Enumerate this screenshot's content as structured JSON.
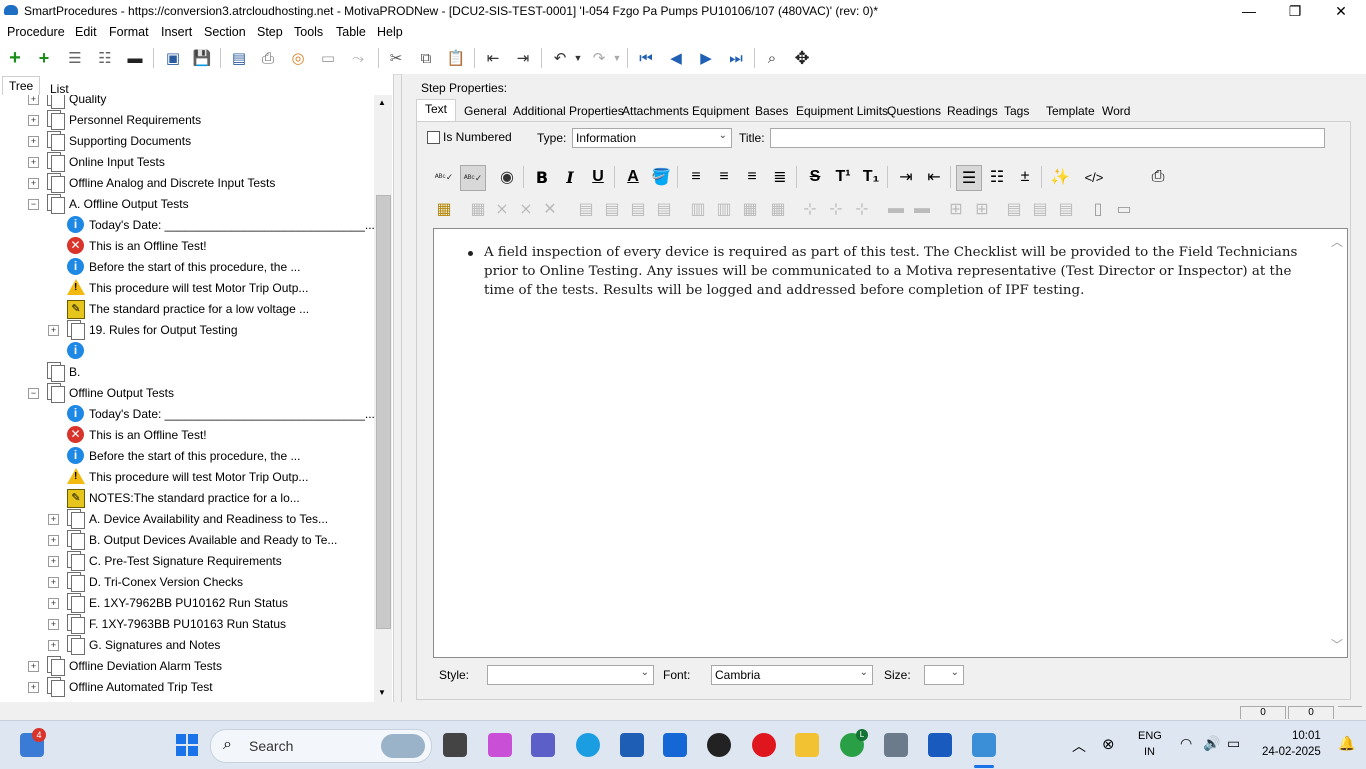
{
  "window": {
    "title": "SmartProcedures - https://conversion3.atrcloudhosting.net - MotivaPRODNew - [DCU2-SIS-TEST-0001] 'I-054 Fzgo Pa Pumps PU10106/107 (480VAC)' (rev: 0)*",
    "minimize": "—",
    "restore": "❐",
    "close": "✕"
  },
  "menu": [
    "Procedure",
    "Edit",
    "Format",
    "Insert",
    "Section",
    "Step",
    "Tools",
    "Table",
    "Help"
  ],
  "left_tabs": [
    "Tree",
    "List"
  ],
  "tree": [
    {
      "label": "Quality",
      "icon": "doc",
      "level": 0,
      "exp": "+"
    },
    {
      "label": "Personnel Requirements",
      "icon": "doc",
      "level": 0,
      "exp": "+"
    },
    {
      "label": "Supporting Documents",
      "icon": "doc",
      "level": 0,
      "exp": "+"
    },
    {
      "label": "Online Input Tests",
      "icon": "doc",
      "level": 0,
      "exp": "+"
    },
    {
      "label": "Offline Analog and Discrete Input Tests",
      "icon": "doc",
      "level": 0,
      "exp": "+"
    },
    {
      "label": "A. Offline Output Tests",
      "icon": "doc",
      "level": 0,
      "exp": "−"
    },
    {
      "label": "Today's Date: ______________________________...",
      "icon": "info",
      "level": 1,
      "exp": ""
    },
    {
      "label": "This is an Offline Test!",
      "icon": "error",
      "level": 1,
      "exp": ""
    },
    {
      "label": "Before the start of this procedure, the ...",
      "icon": "info",
      "level": 1,
      "exp": ""
    },
    {
      "label": "This procedure will test Motor Trip Outp...",
      "icon": "warn",
      "level": 1,
      "exp": ""
    },
    {
      "label": "The standard practice for a low voltage ...",
      "icon": "sticky",
      "level": 1,
      "exp": ""
    },
    {
      "label": "19. Rules for Output Testing",
      "icon": "doc",
      "level": 1,
      "exp": "+"
    },
    {
      "label": "",
      "icon": "info",
      "level": 1,
      "exp": ""
    },
    {
      "label": "B.",
      "icon": "doc",
      "level": 0,
      "exp": ""
    },
    {
      "label": "Offline Output Tests",
      "icon": "doc",
      "level": 0,
      "exp": "−"
    },
    {
      "label": "Today's Date: ______________________________...",
      "icon": "info",
      "level": 1,
      "exp": ""
    },
    {
      "label": "This is an Offline Test!",
      "icon": "error",
      "level": 1,
      "exp": ""
    },
    {
      "label": "Before the start of this procedure, the ...",
      "icon": "info",
      "level": 1,
      "exp": ""
    },
    {
      "label": "This procedure will test Motor Trip Outp...",
      "icon": "warn",
      "level": 1,
      "exp": ""
    },
    {
      "label": "NOTES:The standard practice for a lo...",
      "icon": "sticky",
      "level": 1,
      "exp": ""
    },
    {
      "label": "A. Device Availability and Readiness to Tes...",
      "icon": "doc",
      "level": 1,
      "exp": "+"
    },
    {
      "label": "B. Output Devices Available and Ready to Te...",
      "icon": "doc",
      "level": 1,
      "exp": "+"
    },
    {
      "label": "C. Pre-Test Signature Requirements",
      "icon": "doc",
      "level": 1,
      "exp": "+"
    },
    {
      "label": "D. Tri-Conex Version Checks",
      "icon": "doc",
      "level": 1,
      "exp": "+"
    },
    {
      "label": "E. 1XY-7962BB PU10162 Run Status",
      "icon": "doc",
      "level": 1,
      "exp": "+"
    },
    {
      "label": "F. 1XY-7963BB PU10163 Run Status",
      "icon": "doc",
      "level": 1,
      "exp": "+"
    },
    {
      "label": "G. Signatures and Notes",
      "icon": "doc",
      "level": 1,
      "exp": "+"
    },
    {
      "label": "Offline Deviation Alarm Tests",
      "icon": "doc",
      "level": 0,
      "exp": "+"
    },
    {
      "label": "Offline Automated Trip Test",
      "icon": "doc",
      "level": 0,
      "exp": "+"
    }
  ],
  "step_properties": {
    "heading": "Step Properties:",
    "tabs": [
      "Text",
      "General",
      "Additional Properties",
      "Attachments",
      "Equipment",
      "Bases",
      "Equipment Limits",
      "Questions",
      "Readings",
      "Tags",
      "Template",
      "Word"
    ],
    "is_numbered_label": "Is Numbered",
    "type_label": "Type:",
    "type_value": "Information",
    "title_label": "Title:",
    "title_value": ""
  },
  "editor": {
    "bullet_text": "A field inspection of every device is required as part of this test. The Checklist will be provided to the Field Technicians prior to Online Testing. Any issues will be communicated to a Motiva representative (Test Director or Inspector) at the time of the tests. Results will be logged and addressed before completion of IPF testing."
  },
  "bottom_fields": {
    "style_label": "Style:",
    "style_value": "",
    "font_label": "Font:",
    "font_value": "Cambria",
    "size_label": "Size:",
    "size_value": ""
  },
  "statusbar": {
    "cell1": "0",
    "cell2": "0"
  },
  "taskbar": {
    "search_placeholder": "Search",
    "badge": "4",
    "chrome_badge": "L",
    "lang_line1": "ENG",
    "lang_line2": "IN",
    "time": "10:01",
    "date": "24-02-2025"
  },
  "colors": {
    "info": "#1e88e5",
    "error": "#d9342b",
    "warn": "#f2b90f",
    "accent": "#1f5fb4"
  }
}
